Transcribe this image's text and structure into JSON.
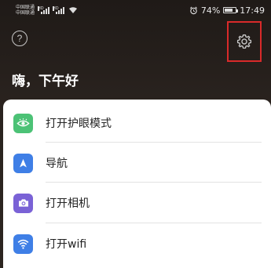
{
  "status_bar": {
    "carrier_1": "中国联通",
    "carrier_2": "中国联通",
    "battery_percent": "74%",
    "battery_level": 0.74,
    "time": "17:49"
  },
  "header": {
    "help_symbol": "?",
    "greeting": "嗨，下午好"
  },
  "actions": [
    {
      "label": "打开护眼模式",
      "icon": "eye-icon",
      "color": "#4cc276"
    },
    {
      "label": "导航",
      "icon": "navigation-arrow-icon",
      "color": "#3f7fe6"
    },
    {
      "label": "打开相机",
      "icon": "camera-icon",
      "color": "#7a62d6"
    },
    {
      "label": "打开wifi",
      "icon": "wifi-icon",
      "color": "#3f7fe6"
    }
  ],
  "colors": {
    "highlight": "#d92a2a",
    "background": "#231d19"
  }
}
